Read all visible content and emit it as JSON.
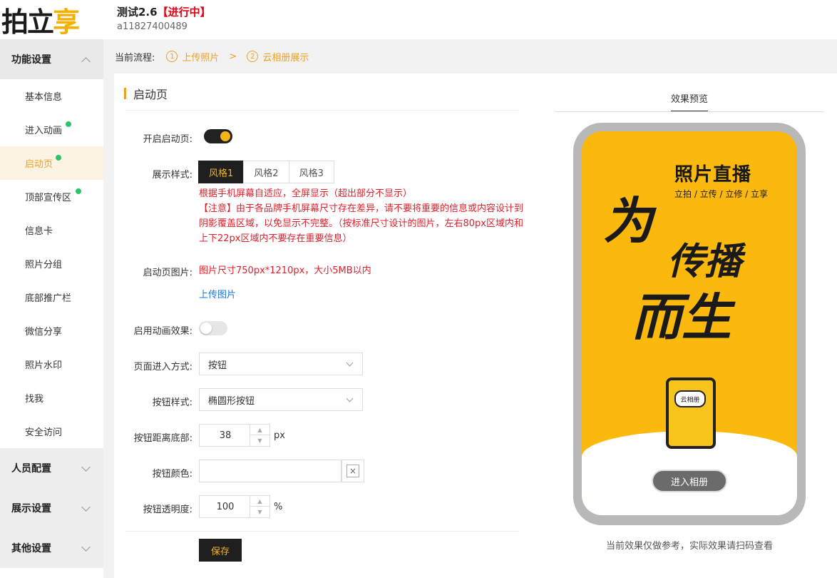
{
  "header": {
    "logo_a": "拍立",
    "logo_b": "享",
    "title": "测试2.6",
    "status": "【进行中】",
    "id_text": "a11827400489"
  },
  "sidebar": {
    "groups": [
      {
        "label": "功能设置",
        "items": [
          {
            "label": "基本信息"
          },
          {
            "label": "进入动画"
          },
          {
            "label": "启动页"
          },
          {
            "label": "顶部宣传区"
          },
          {
            "label": "信息卡"
          },
          {
            "label": "照片分组"
          },
          {
            "label": "底部推广栏"
          },
          {
            "label": "微信分享"
          },
          {
            "label": "照片水印"
          },
          {
            "label": "找我"
          },
          {
            "label": "安全访问"
          }
        ]
      },
      {
        "label": "人员配置"
      },
      {
        "label": "展示设置"
      },
      {
        "label": "其他设置"
      }
    ]
  },
  "process": {
    "label": "当前流程:",
    "steps": [
      {
        "num": "1",
        "label": "上传照片"
      },
      {
        "num": "2",
        "label": "云相册展示"
      }
    ],
    "sep": ">"
  },
  "form": {
    "section_title": "启动页",
    "enable_label": "开启启动页:",
    "style_label": "展示样式:",
    "styles": [
      "风格1",
      "风格2",
      "风格3"
    ],
    "notes": [
      "根据手机屏幕自适应，全屏显示（超出部分不显示）",
      "【注意】由于各品牌手机屏幕尺寸存在差异，请不要将重要的信息或内容设计到阴影覆盖区域，以免显示不完整。（按标准尺寸设计的图片，左右80px区域内和上下22px区域内不要存在重要信息）"
    ],
    "image_label": "启动页图片:",
    "image_hint": "图片尺寸750px*1210px，大小5MB以内",
    "upload_link": "上传图片",
    "anim_label": "启用动画效果:",
    "enter_label": "页面进入方式:",
    "enter_value": "按钮",
    "btnstyle_label": "按钮样式:",
    "btnstyle_value": "椭圆形按钮",
    "bottom_label": "按钮距离底部:",
    "bottom_value": "38",
    "bottom_unit": "px",
    "color_label": "按钮颜色:",
    "color_clear": "×",
    "opacity_label": "按钮透明度:",
    "opacity_value": "100",
    "opacity_unit": "%",
    "save": "保存"
  },
  "preview": {
    "title": "效果预览",
    "badge_title": "照片直播",
    "badge_sub": "立拍 / 立传 / 立修 / 立享",
    "slogan_1": "为",
    "slogan_2": "传播",
    "slogan_3": "而生",
    "app_label": "云相册",
    "enter_btn": "进入相册",
    "note": "当前效果仅做参考，实际效果请扫码查看"
  },
  "colors": {
    "accent": "#f0a020",
    "dark": "#1f1f1f",
    "warn": "#e0202a",
    "link": "#1e78d6",
    "preview_bg": "#fbb80d"
  }
}
